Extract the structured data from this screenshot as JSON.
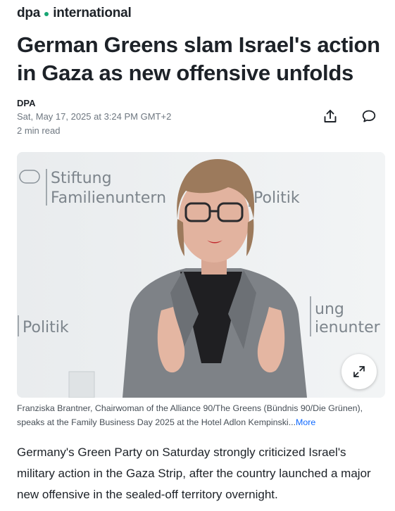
{
  "brand": {
    "name": "dpa",
    "suffix": "international",
    "dot_color": "#17a673"
  },
  "article": {
    "title": "German Greens slam Israel's action in Gaza as new offensive unfolds",
    "author": "DPA",
    "date": "Sat, May 17, 2025 at 3:24 PM GMT+2",
    "read_time": "2 min read"
  },
  "actions": {
    "share_icon": "share-icon",
    "comment_icon": "comment-icon",
    "expand_icon": "expand-icon"
  },
  "image": {
    "backdrop_text_left_1": "Stiftung",
    "backdrop_text_left_2": "Familienuntern",
    "backdrop_text_right_1": "Politik",
    "backdrop_text_lower_left": "Politik",
    "backdrop_text_lower_right_1": "ung",
    "backdrop_text_lower_right_2": "ienunter"
  },
  "caption": {
    "text": "Franziska Brantner, Chairwoman of the Alliance 90/The Greens (Bündnis 90/Die Grünen), speaks at the Family Business Day 2025 at the Hotel Adlon Kempinski...",
    "more_label": "More"
  },
  "body": {
    "paragraph_1": "Germany's Green Party on Saturday strongly criticized Israel's military action in the Gaza Strip, after the country launched a major new offensive in the sealed-off territory overnight."
  }
}
